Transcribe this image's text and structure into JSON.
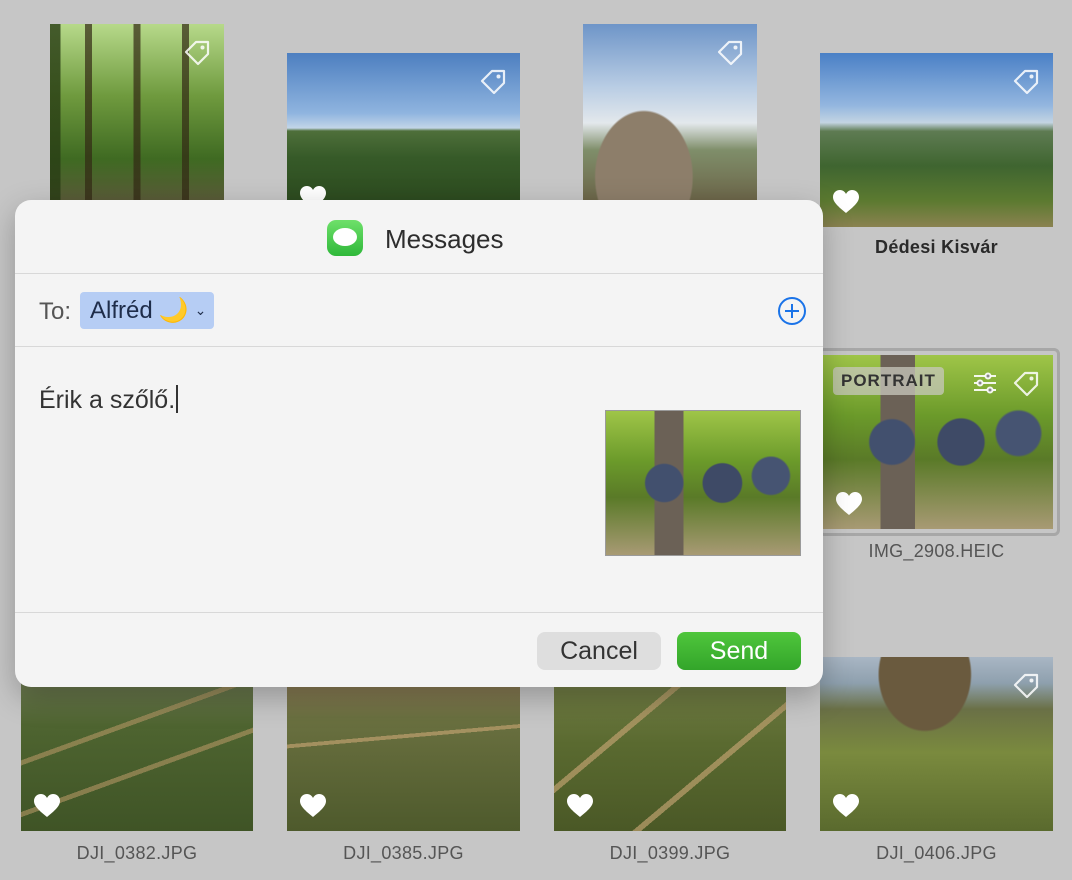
{
  "grid": {
    "top_row": [
      {
        "style": "forest"
      },
      {
        "style": "valley1",
        "favorited": true
      },
      {
        "style": "rock"
      },
      {
        "style": "dedes",
        "caption": "Dédesi Kisvár",
        "favorited": true
      }
    ],
    "portrait_photo": {
      "badge": "PORTRAIT",
      "caption": "IMG_2908.HEIC",
      "favorited": true
    },
    "bottom_row": [
      {
        "caption": "DJI_0382.JPG"
      },
      {
        "caption": "DJI_0385.JPG"
      },
      {
        "caption": "DJI_0399.JPG"
      },
      {
        "caption": "DJI_0406.JPG"
      }
    ]
  },
  "dialog": {
    "title": "Messages",
    "to_label": "To:",
    "recipient": "Alfréd",
    "recipient_emoji": "🌙",
    "message_text": "Érik a szőlő.",
    "cancel_label": "Cancel",
    "send_label": "Send"
  },
  "colors": {
    "send_button": "#33a52a",
    "recipient_chip": "#b6cdf4",
    "add_button": "#1a73e8"
  },
  "icons": [
    "tag-icon",
    "heart-icon",
    "adjust-icon",
    "messages-app-icon",
    "add-circle-icon",
    "chevron-down-icon"
  ]
}
